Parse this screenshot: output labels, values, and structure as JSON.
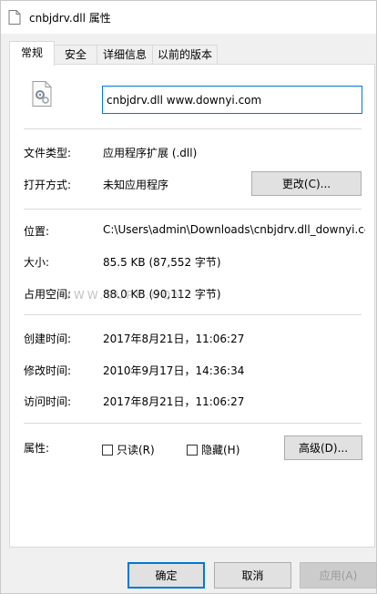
{
  "window": {
    "title": "cnbjdrv.dll 属性"
  },
  "tabs": [
    {
      "label": "常规",
      "active": true
    },
    {
      "label": "安全",
      "active": false
    },
    {
      "label": "详细信息",
      "active": false
    },
    {
      "label": "以前的版本",
      "active": false
    }
  ],
  "general": {
    "filename": "cnbjdrv.dll www.downyi.com",
    "file_type_label": "文件类型:",
    "file_type_value": "应用程序扩展 (.dll)",
    "opens_with_label": "打开方式:",
    "opens_with_value": "未知应用程序",
    "change_button": "更改(C)...",
    "location_label": "位置:",
    "location_value": "C:\\Users\\admin\\Downloads\\cnbjdrv.dll_downyi.cc",
    "size_label": "大小:",
    "size_value": "85.5 KB (87,552 字节)",
    "size_on_disk_label": "占用空间:",
    "size_on_disk_value": "88.0 KB (90,112 字节)",
    "created_label": "创建时间:",
    "created_value": "2017年8月21日，11:06:27",
    "modified_label": "修改时间:",
    "modified_value": "2010年9月17日，14:36:34",
    "accessed_label": "访问时间:",
    "accessed_value": "2017年8月21日，11:06:27",
    "attributes_label": "属性:",
    "readonly_label": "只读(R)",
    "hidden_label": "隐藏(H)",
    "advanced_button": "高级(D)...",
    "watermark": "WWW.9UPK.COM"
  },
  "footer": {
    "ok": "确定",
    "cancel": "取消",
    "apply": "应用(A)"
  },
  "colors": {
    "accent": "#0078d7",
    "panel": "#ffffff",
    "chrome": "#f0f0f0"
  }
}
